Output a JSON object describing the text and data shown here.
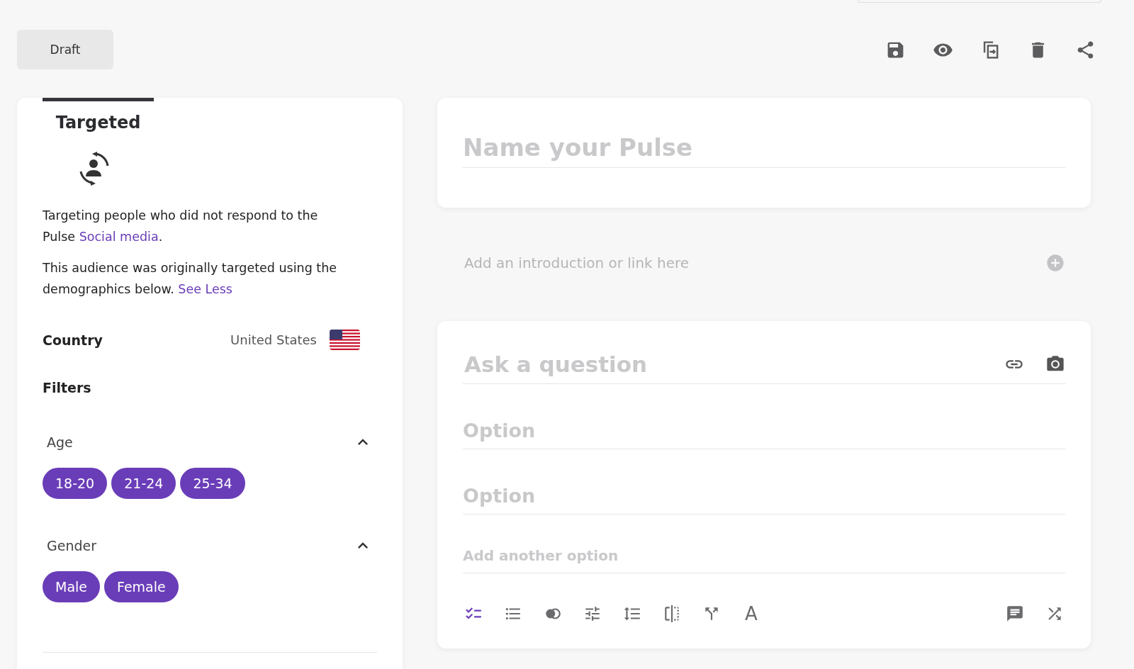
{
  "status": {
    "label": "Draft"
  },
  "audience": {
    "tab": {
      "label": "Targeted",
      "selected": true
    },
    "description": [
      {
        "text": "Targeting people who did not respond to the Pulse ",
        "link": "Social media",
        "after": "."
      },
      {
        "text": "This audience was originally targeted using the demographics below. ",
        "link": "See Less"
      }
    ],
    "country": {
      "label": "Country",
      "value": "United States"
    },
    "filters_title": "Filters",
    "filters": [
      {
        "label": "Age",
        "expanded": true,
        "chips": [
          {
            "label": "18-20",
            "selected": true
          },
          {
            "label": "21-24",
            "selected": true
          },
          {
            "label": "25-34",
            "selected": true
          }
        ]
      },
      {
        "label": "Gender",
        "expanded": true,
        "chips": [
          {
            "label": "Male",
            "selected": true
          },
          {
            "label": "Female",
            "selected": true
          }
        ]
      }
    ]
  },
  "title_field": {
    "placeholder": "Name your Pulse"
  },
  "intro_field": {
    "placeholder": "Add an introduction or link here"
  },
  "question": {
    "placeholder": "Ask a question",
    "options": [
      {
        "placeholder": "Option"
      },
      {
        "placeholder": "Option"
      }
    ],
    "add_option": {
      "placeholder": "Add another option"
    },
    "tools": [
      {
        "kind": "icon",
        "selected": true
      },
      {
        "kind": "icon",
        "selected": false
      },
      {
        "kind": "icon",
        "selected": false
      },
      {
        "kind": "icon",
        "selected": false
      },
      {
        "kind": "icon",
        "selected": false
      },
      {
        "kind": "icon",
        "selected": false
      },
      {
        "kind": "icon",
        "selected": false
      },
      {
        "kind": "text",
        "label": "A",
        "selected": false
      }
    ]
  }
}
